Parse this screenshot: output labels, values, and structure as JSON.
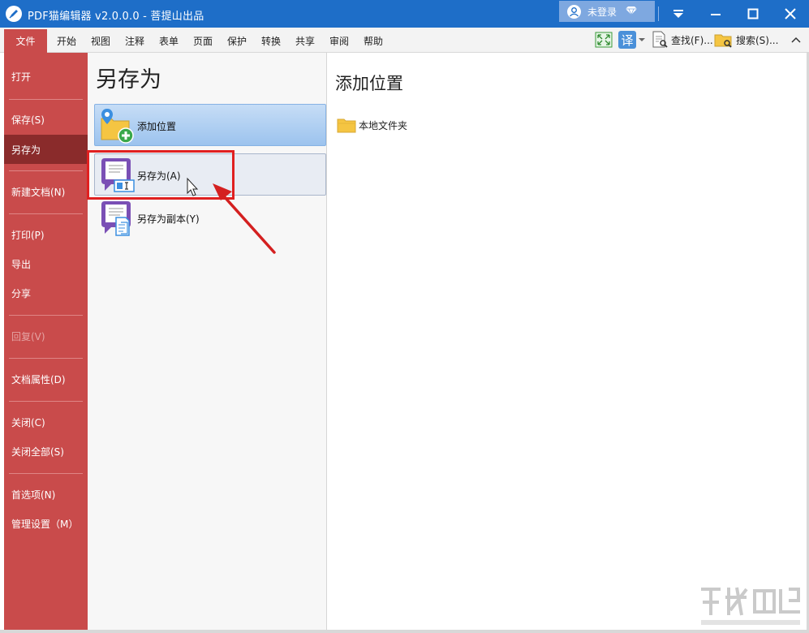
{
  "titlebar": {
    "title": "PDF猫编辑器 v2.0.0.0 - 菩提山出品",
    "login_label": "未登录"
  },
  "menubar": {
    "file_tab": "文件",
    "items": [
      "开始",
      "视图",
      "注释",
      "表单",
      "页面",
      "保护",
      "转换",
      "共享",
      "审阅",
      "帮助"
    ],
    "translate_label": "译",
    "find_label": "查找(F)...",
    "search_label": "搜索(S)..."
  },
  "sidebar": {
    "items": [
      {
        "label": "打开"
      },
      {
        "label": "保存(S)"
      },
      {
        "label": "另存为",
        "active": true
      },
      {
        "label": "新建文档(N)"
      },
      {
        "label": "打印(P)"
      },
      {
        "label": "导出"
      },
      {
        "label": "分享"
      },
      {
        "label": "回复(V)",
        "disabled": true
      },
      {
        "label": "文档属性(D)"
      },
      {
        "label": "关闭(C)"
      },
      {
        "label": "关闭全部(S)"
      },
      {
        "label": "首选项(N)"
      },
      {
        "label": "管理设置（M）"
      }
    ]
  },
  "middle": {
    "heading": "另存为",
    "options": {
      "add_location": "添加位置",
      "save_as": "另存为(A)",
      "save_copy": "另存为副本(Y)"
    }
  },
  "right": {
    "heading": "添加位置",
    "locations": [
      "本地文件夹"
    ]
  },
  "colors": {
    "titlebar": "#1e6ec8",
    "sidebar": "#c94b4b",
    "sidebar_active": "#8a2b2b",
    "annotation": "#e02020"
  }
}
